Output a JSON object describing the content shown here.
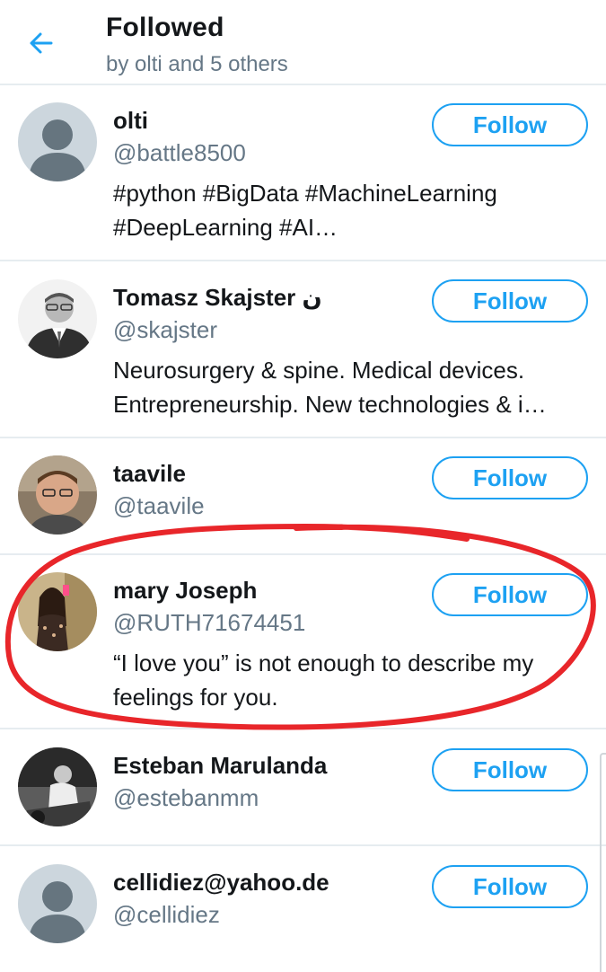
{
  "header": {
    "title": "Followed",
    "subtitle": "by olti and 5 others",
    "back_icon": "arrow-left-icon"
  },
  "users": [
    {
      "name": "olti",
      "handle": "@battle8500",
      "bio": "#python #BigData #MachineLearning #DeepLearning #AI…",
      "follow_label": "Follow",
      "avatar": "default-avatar"
    },
    {
      "name": "Tomasz Skajster ن",
      "handle": "@skajster",
      "bio": "Neurosurgery & spine. Medical devices. Entrepreneurship. New technologies & i…",
      "follow_label": "Follow",
      "avatar": "photo-man-grayscale"
    },
    {
      "name": "taavile",
      "handle": "@taavile",
      "bio": "",
      "follow_label": "Follow",
      "avatar": "photo-man-glasses"
    },
    {
      "name": "mary Joseph",
      "handle": "@RUTH71674451",
      "bio": "“I love you” is not enough to describe my feelings for you.",
      "follow_label": "Follow",
      "avatar": "photo-woman-selfie"
    },
    {
      "name": "Esteban Marulanda",
      "handle": "@estebanmm",
      "bio": "",
      "follow_label": "Follow",
      "avatar": "photo-man-bw"
    },
    {
      "name": "cellidiez@yahoo.de",
      "handle": "@cellidiez",
      "bio": "",
      "follow_label": "Follow",
      "avatar": "default-avatar"
    }
  ],
  "colors": {
    "accent": "#1da1f2",
    "secondary_text": "#657786",
    "divider": "#e6ecf0",
    "highlight_circle": "#e8262a"
  }
}
